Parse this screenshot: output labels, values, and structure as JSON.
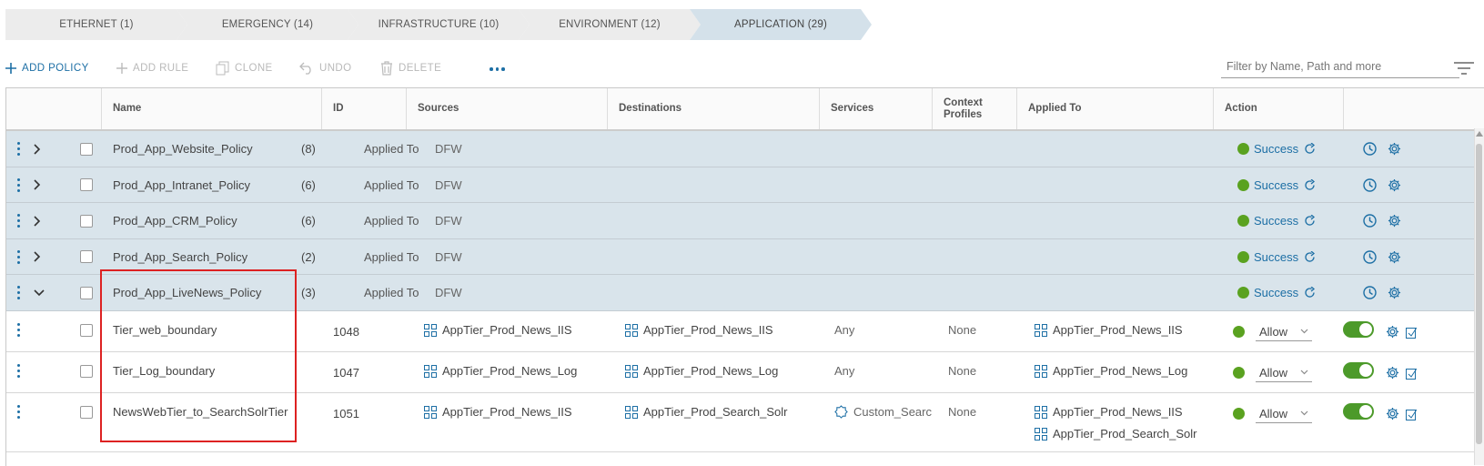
{
  "breadcrumbs": [
    {
      "label": "ETHERNET (1)",
      "active": false
    },
    {
      "label": "EMERGENCY (14)",
      "active": false
    },
    {
      "label": "INFRASTRUCTURE (10)",
      "active": false
    },
    {
      "label": "ENVIRONMENT (12)",
      "active": false
    },
    {
      "label": "APPLICATION (29)",
      "active": true
    }
  ],
  "toolbar": {
    "add_policy": "ADD POLICY",
    "add_rule": "ADD RULE",
    "clone": "CLONE",
    "undo": "UNDO",
    "delete": "DELETE",
    "filter_placeholder": "Filter by Name, Path and more"
  },
  "columns": {
    "name": "Name",
    "id": "ID",
    "sources": "Sources",
    "destinations": "Destinations",
    "services": "Services",
    "context_profiles_1": "Context",
    "context_profiles_2": "Profiles",
    "applied_to": "Applied To",
    "action": "Action"
  },
  "policies": [
    {
      "name": "Prod_App_Website_Policy",
      "count": "(8)",
      "applied_label": "Applied To",
      "applied_value": "DFW",
      "status": "Success",
      "expanded": false
    },
    {
      "name": "Prod_App_Intranet_Policy",
      "count": "(6)",
      "applied_label": "Applied To",
      "applied_value": "DFW",
      "status": "Success",
      "expanded": false
    },
    {
      "name": "Prod_App_CRM_Policy",
      "count": "(6)",
      "applied_label": "Applied To",
      "applied_value": "DFW",
      "status": "Success",
      "expanded": false
    },
    {
      "name": "Prod_App_Search_Policy",
      "count": "(2)",
      "applied_label": "Applied To",
      "applied_value": "DFW",
      "status": "Success",
      "expanded": false
    },
    {
      "name": "Prod_App_LiveNews_Policy",
      "count": "(3)",
      "applied_label": "Applied To",
      "applied_value": "DFW",
      "status": "Success",
      "expanded": true
    }
  ],
  "rules": [
    {
      "name": "Tier_web_boundary",
      "id": "1048",
      "source": "AppTier_Prod_News_IIS",
      "destination": "AppTier_Prod_News_IIS",
      "service": "Any",
      "context": "None",
      "applied_to": [
        "AppTier_Prod_News_IIS"
      ],
      "action": "Allow",
      "enabled": true
    },
    {
      "name": "Tier_Log_boundary",
      "id": "1047",
      "source": "AppTier_Prod_News_Log",
      "destination": "AppTier_Prod_News_Log",
      "service": "Any",
      "context": "None",
      "applied_to": [
        "AppTier_Prod_News_Log"
      ],
      "action": "Allow",
      "enabled": true
    },
    {
      "name": "NewsWebTier_to_SearchSolrTier",
      "id": "1051",
      "source": "AppTier_Prod_News_IIS",
      "destination": "AppTier_Prod_Search_Solr",
      "service": "Custom_Searc",
      "context": "None",
      "applied_to": [
        "AppTier_Prod_News_IIS",
        "AppTier_Prod_Search_Solr"
      ],
      "action": "Allow",
      "enabled": true
    }
  ],
  "colors": {
    "accent": "#1d6fa5",
    "success": "#5aa220",
    "policy_row": "#d9e4eb",
    "highlight": "#dd2222"
  }
}
